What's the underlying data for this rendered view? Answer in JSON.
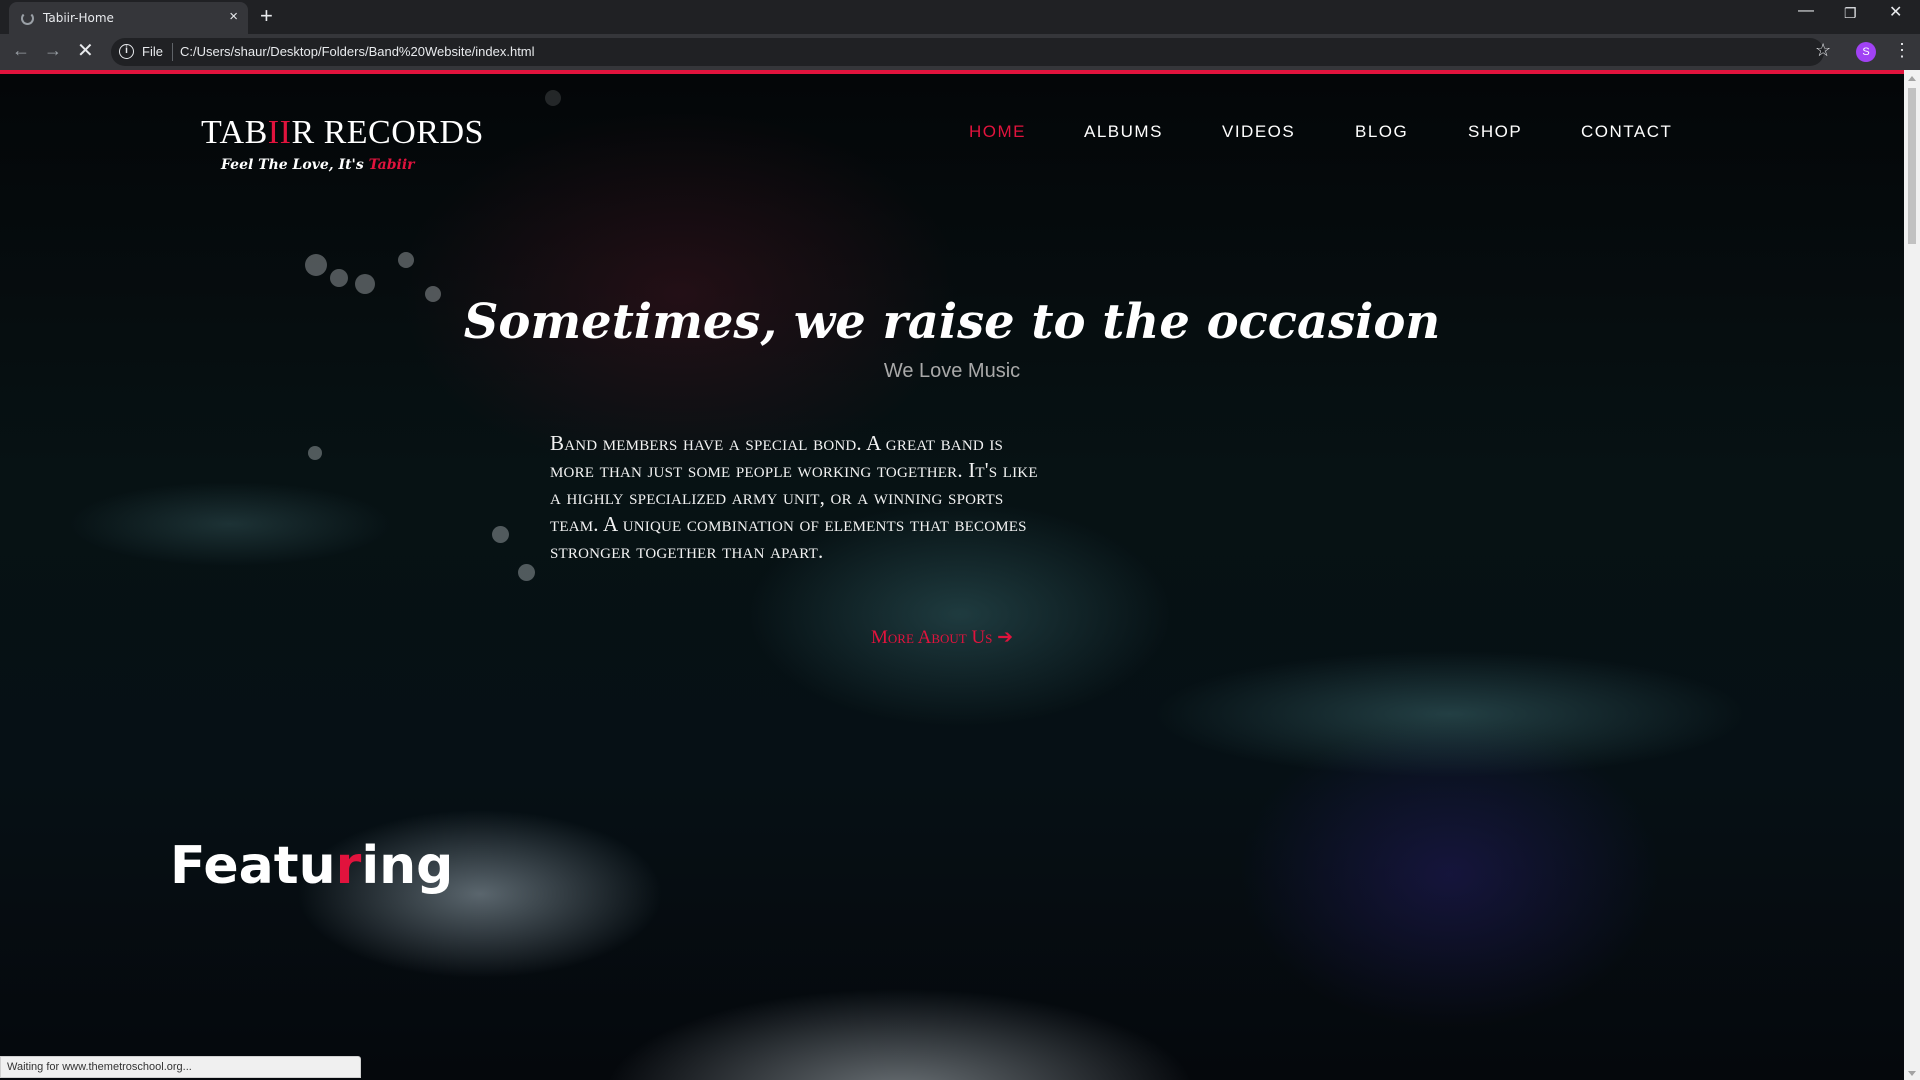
{
  "browser": {
    "tab_title": "Tabiir-Home",
    "tab_close": "×",
    "new_tab": "+",
    "omnibox_scheme": "File",
    "url": "C:/Users/shaur/Desktop/Folders/Band%20Website/index.html",
    "profile_initial": "S",
    "status_text": "Waiting for www.themetroschool.org..."
  },
  "site": {
    "logo_part1": "TAB",
    "logo_accent": "II",
    "logo_part2": "R RECORDS",
    "tagline": "Feel The Love, It's ",
    "tagline_accent": "Tabiir",
    "accent_color": "#e1133d"
  },
  "nav": {
    "items": [
      {
        "label": "HOME",
        "active": true
      },
      {
        "label": "ALBUMS"
      },
      {
        "label": "VIDEOS"
      },
      {
        "label": "BLOG"
      },
      {
        "label": "SHOP"
      },
      {
        "label": "CONTACT"
      }
    ]
  },
  "hero": {
    "title": "Sometimes, we raise to the occasion",
    "subtitle": "We Love Music",
    "body": "Band members have a special bond. A great band is more than just some people working together. It's like a highly specialized army unit, or a winning sports team. A unique combination of elements that becomes stronger together than apart.",
    "more_label": "More About Us",
    "more_arrow": "➔"
  },
  "featuring": {
    "part1": "Featu",
    "accent": "r",
    "part2": "ing"
  }
}
